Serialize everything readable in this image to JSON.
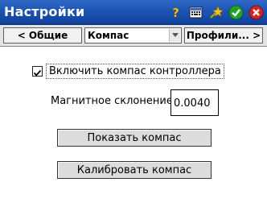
{
  "window": {
    "title": "Настройки"
  },
  "title_icons": [
    {
      "name": "help-icon",
      "color": "#f3d62f"
    },
    {
      "name": "keyboard-icon",
      "color": "#3b6ccf"
    },
    {
      "name": "star-icon",
      "color": "#f0c11e"
    },
    {
      "name": "ok-icon",
      "color": "#22a326"
    },
    {
      "name": "close-icon",
      "color": "#d42323"
    }
  ],
  "nav": {
    "prev_label": "< Общие",
    "current_page": "Компас",
    "next_label": "Профили... >"
  },
  "options": {
    "enable_compass": {
      "label": "Включить компас контроллера",
      "checked": true
    },
    "magnetic_declination": {
      "label": "Магнитное склонение:",
      "value": "0.0040"
    }
  },
  "buttons": {
    "show_compass": "Показать компас",
    "calibrate_compass": "Калибровать компас"
  }
}
